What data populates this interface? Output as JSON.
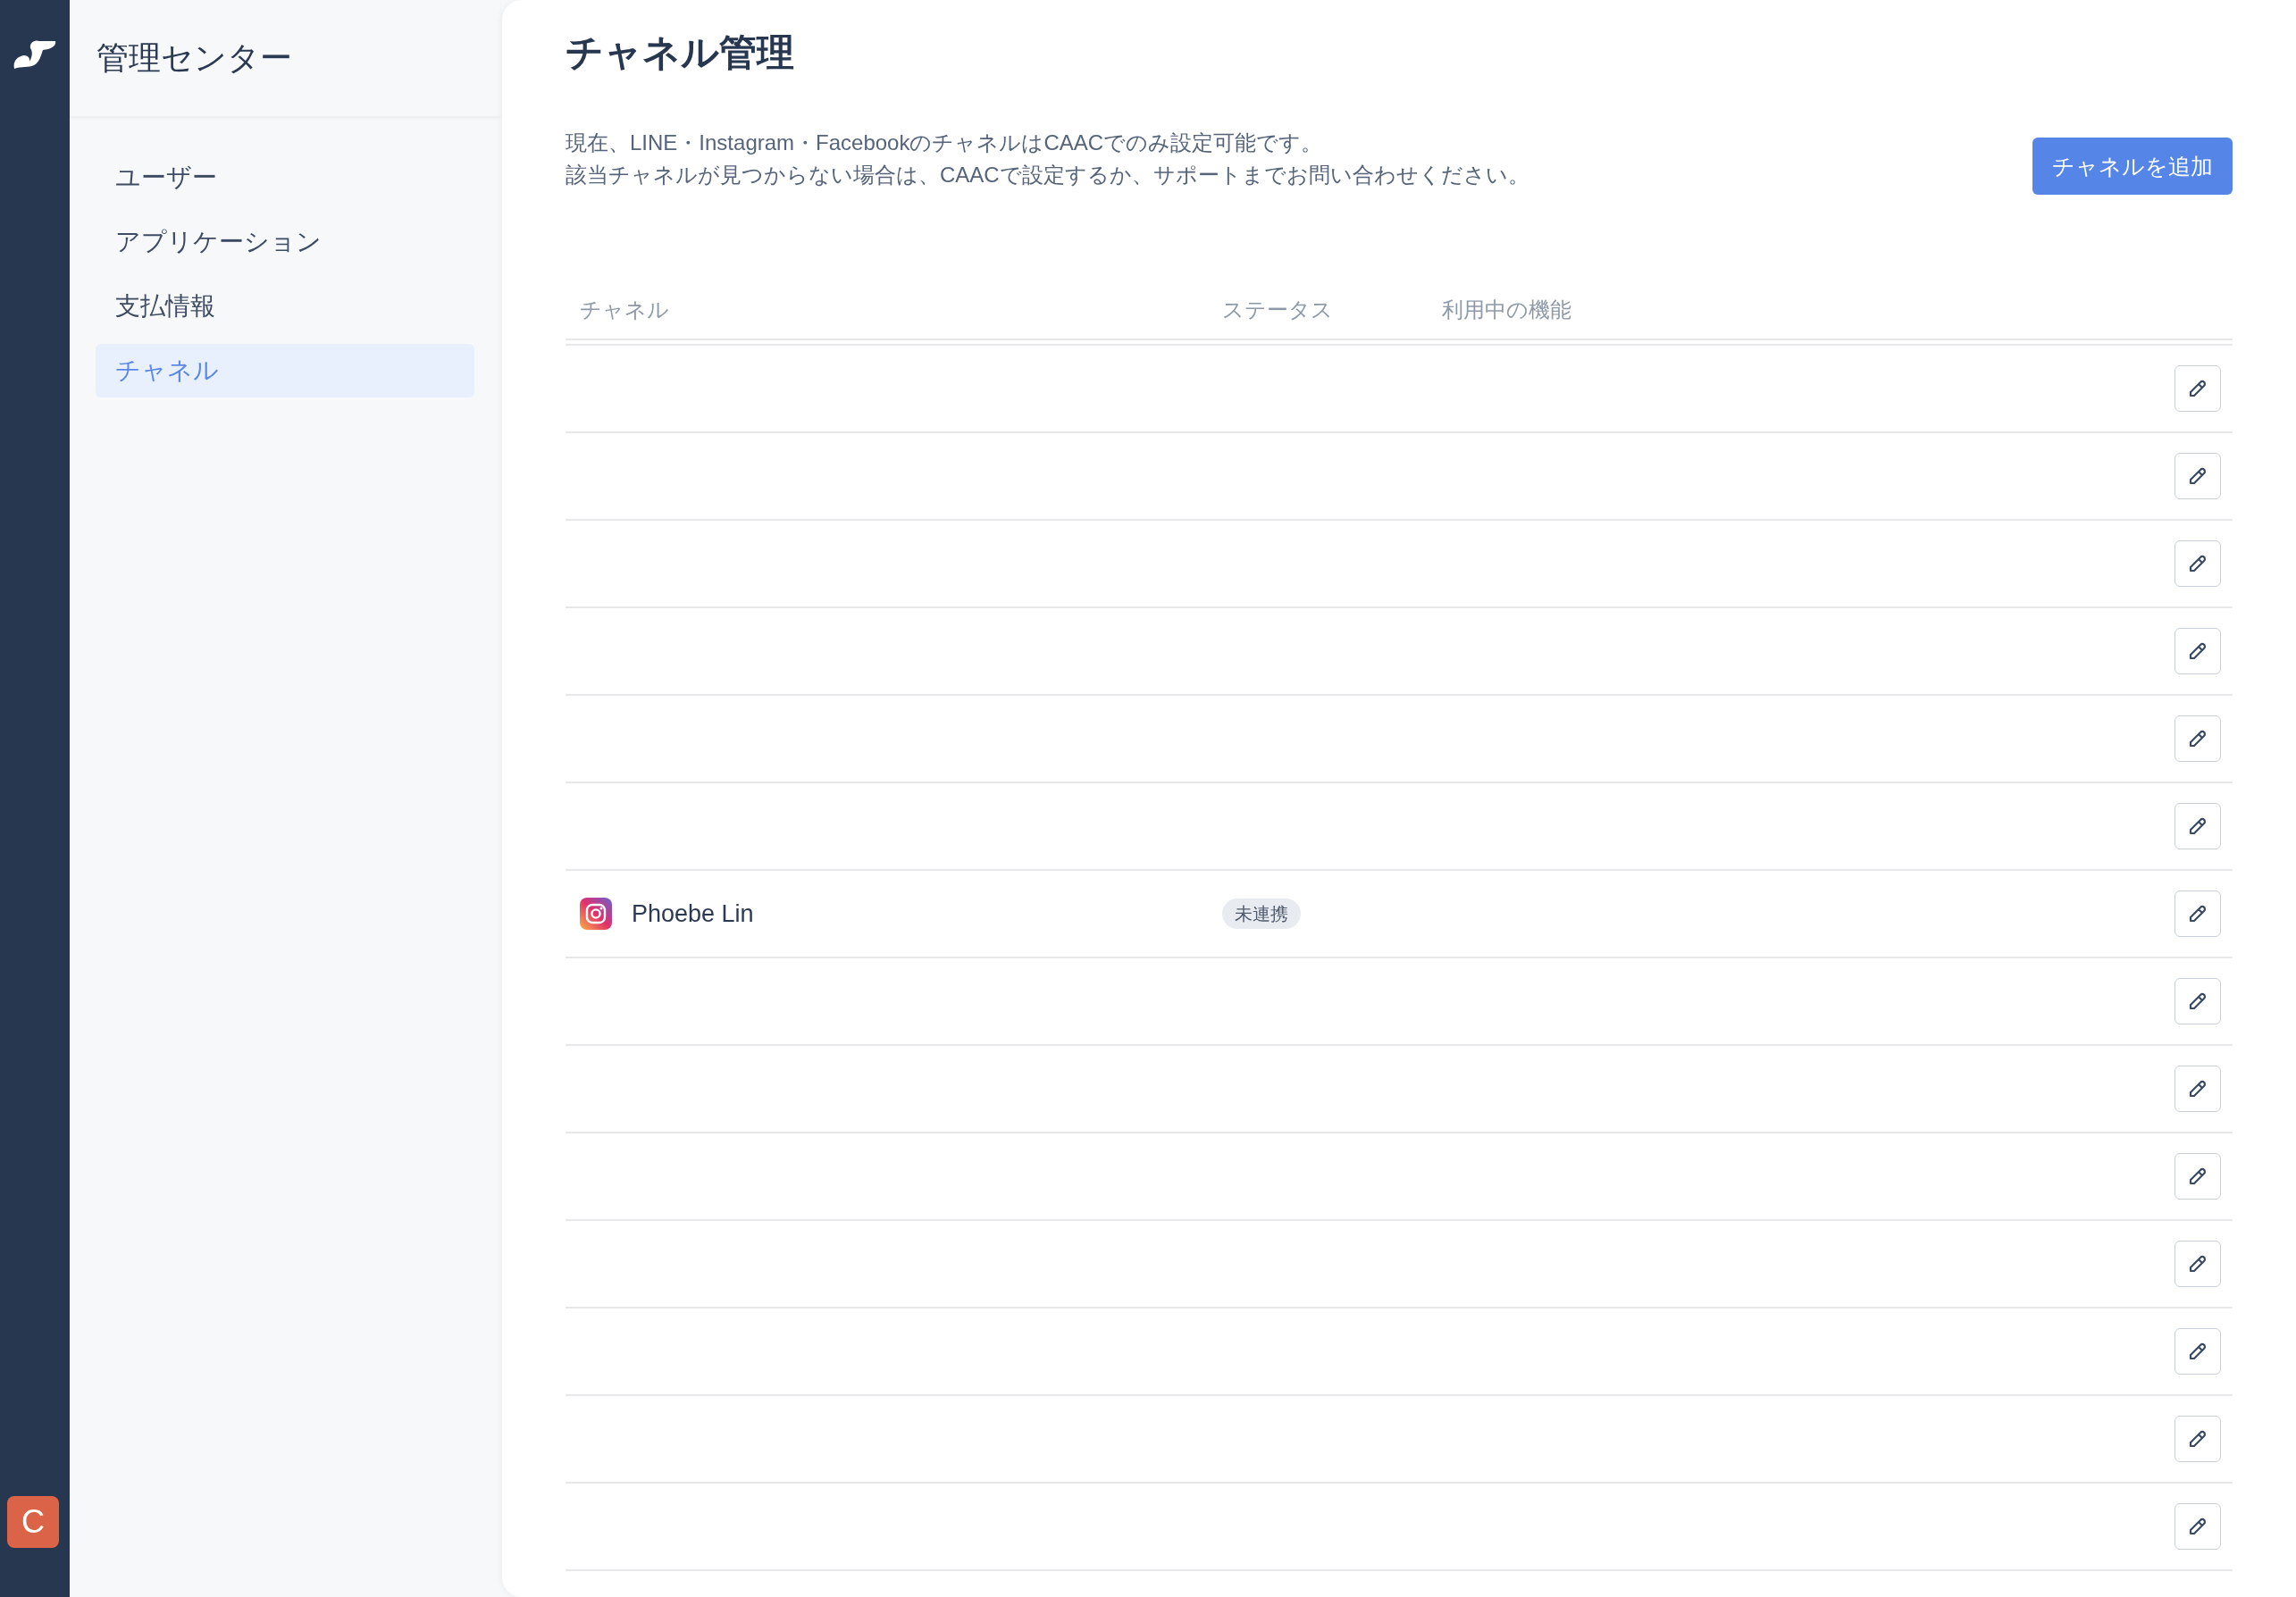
{
  "rail": {
    "avatar": "C"
  },
  "nav": {
    "title": "管理センター",
    "items": [
      {
        "label": "ユーザー",
        "selected": false
      },
      {
        "label": "アプリケーション",
        "selected": false
      },
      {
        "label": "支払情報",
        "selected": false
      },
      {
        "label": "チャネル",
        "selected": true
      }
    ]
  },
  "page": {
    "title": "チャネル管理",
    "notice": [
      "現在、LINE・Instagram・FacebookのチャネルはCAACでのみ設定可能です。",
      "該当チャネルが見つからない場合は、CAACで設定するか、サポートまでお問い合わせください。"
    ],
    "add_button": "チャネルを追加"
  },
  "table": {
    "columns": [
      "チャネル",
      "ステータス",
      "利用中の機能"
    ],
    "rows": [
      {
        "kind": "empty"
      },
      {
        "kind": "empty"
      },
      {
        "kind": "empty"
      },
      {
        "kind": "empty"
      },
      {
        "kind": "empty"
      },
      {
        "kind": "empty"
      },
      {
        "kind": "channel",
        "name": "Phoebe Lin",
        "status": "未連携"
      },
      {
        "kind": "empty"
      },
      {
        "kind": "empty"
      },
      {
        "kind": "empty"
      },
      {
        "kind": "empty"
      },
      {
        "kind": "empty"
      },
      {
        "kind": "empty"
      },
      {
        "kind": "empty"
      }
    ]
  }
}
